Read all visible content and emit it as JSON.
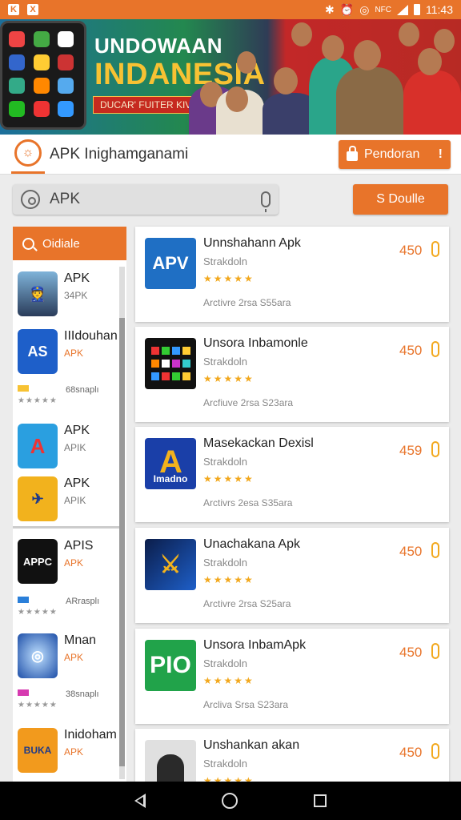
{
  "status_bar": {
    "left_icons": [
      "K",
      "X"
    ],
    "time": "11:43",
    "icons": [
      "bluetooth-icon",
      "alarm-icon",
      "alarm-icon",
      "nfc-icon",
      "signal-icon",
      "battery-icon"
    ]
  },
  "banner": {
    "title_line1": "UNDOWAAN",
    "title_line2": "INDANESIA",
    "tagline": "DUCAR' FUITER KIVN"
  },
  "header": {
    "title": "APK Inighamganami",
    "button_label": "Pendoran",
    "button_badge": "!"
  },
  "search": {
    "value": "APK",
    "button_label": "S Doulle"
  },
  "sidebar": {
    "tab_label": "Oidiale",
    "items": [
      {
        "name": "APK",
        "sub": "34PK"
      },
      {
        "name": "IIIdouhan",
        "sub": "APK"
      },
      {
        "name": "APK",
        "sub": "APIK"
      },
      {
        "name": "APK",
        "sub": "APIK"
      },
      {
        "name": "APIS",
        "sub": "APK"
      },
      {
        "name": "Mnan",
        "sub": "APK"
      },
      {
        "name": "Inidoham",
        "sub": "APK"
      }
    ],
    "extras": [
      "68snaplı",
      "ARrasplı",
      "38snaplı"
    ],
    "stars": "★★★★★"
  },
  "apps": [
    {
      "title": "Unnshahann Apk",
      "sub": "Strakdoln",
      "stars": "★★★★★",
      "meta": "Arctivre 2rsa  S55ara",
      "count": "450",
      "icon_text": "APV"
    },
    {
      "title": "Unsora Inbamonle",
      "sub": "Strakdoln",
      "stars": "★★★★★",
      "meta": "Arcfiuve 2rsa  S23ara",
      "count": "450",
      "icon_text": ""
    },
    {
      "title": "Masekackan Dexisl",
      "sub": "Strakdoln",
      "stars": "★★★★★",
      "meta": "Arctivrs 2esa  S35ara",
      "count": "459",
      "icon_text": "Imadno"
    },
    {
      "title": "Unachakana Apk",
      "sub": "Strakdoln",
      "stars": "★★★★★",
      "meta": "Arctivre 2rsa  S25ara",
      "count": "450",
      "icon_text": ""
    },
    {
      "title": "Unsora InbamApk",
      "sub": "Strakdoln",
      "stars": "★★★★★",
      "meta": "Arcliva Srsa  S23ara",
      "count": "450",
      "icon_text": "PIO"
    },
    {
      "title": "Unshankan akan",
      "sub": "Strakdoln",
      "stars": "★★★★★",
      "meta": "",
      "count": "450",
      "icon_text": ""
    }
  ]
}
